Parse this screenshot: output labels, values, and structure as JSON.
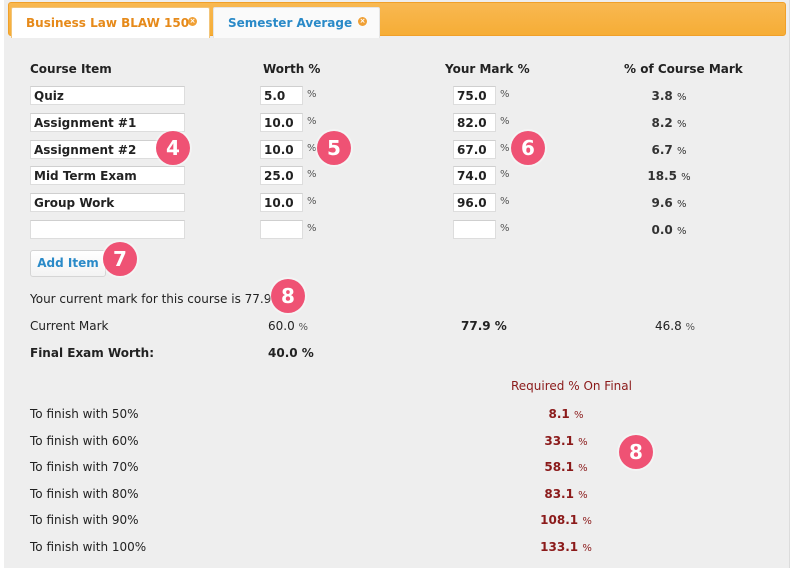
{
  "tabs": [
    {
      "label": "Business Law BLAW 150",
      "active": true,
      "close_icon": "close-circle-icon"
    },
    {
      "label": "Semester Average",
      "active": false,
      "close_icon": "close-circle-icon"
    }
  ],
  "table": {
    "headers": {
      "item": "Course Item",
      "worth": "Worth %",
      "mark": "Your Mark %",
      "course_mark": "% of Course Mark"
    },
    "pct_symbol": "%",
    "rows": [
      {
        "item": "Quiz",
        "worth": "5.0",
        "mark": "75.0",
        "course_mark": "3.8"
      },
      {
        "item": "Assignment #1",
        "worth": "10.0",
        "mark": "82.0",
        "course_mark": "8.2"
      },
      {
        "item": "Assignment #2",
        "worth": "10.0",
        "mark": "67.0",
        "course_mark": "6.7"
      },
      {
        "item": "Mid Term Exam",
        "worth": "25.0",
        "mark": "74.0",
        "course_mark": "18.5"
      },
      {
        "item": "Group Work",
        "worth": "10.0",
        "mark": "96.0",
        "course_mark": "9.6"
      },
      {
        "item": "",
        "worth": "",
        "mark": "",
        "course_mark": "0.0"
      }
    ]
  },
  "add_item_label": "Add Item",
  "summary": {
    "current_mark_sentence": "Your current mark for this course is 77.9",
    "current_mark_label": "Current Mark",
    "current_mark_worth": "60.0",
    "current_mark_value": "77.9 %",
    "current_mark_course": "46.8",
    "final_exam_label": "Final Exam Worth:",
    "final_exam_worth": "40.0"
  },
  "required": {
    "header": "Required % On Final",
    "rows": [
      {
        "label": "To finish with 50%",
        "value": "8.1"
      },
      {
        "label": "To finish with 60%",
        "value": "33.1"
      },
      {
        "label": "To finish with 70%",
        "value": "58.1"
      },
      {
        "label": "To finish with 80%",
        "value": "83.1"
      },
      {
        "label": "To finish with 90%",
        "value": "108.1"
      },
      {
        "label": "To finish with 100%",
        "value": "133.1"
      }
    ]
  },
  "annotations": [
    "4",
    "5",
    "6",
    "7",
    "8",
    "8"
  ],
  "colors": {
    "accent_orange": "#f6ad36",
    "link_blue": "#2a8ac8",
    "badge_pink": "#ef5274",
    "required_red": "#8b1a1a"
  }
}
